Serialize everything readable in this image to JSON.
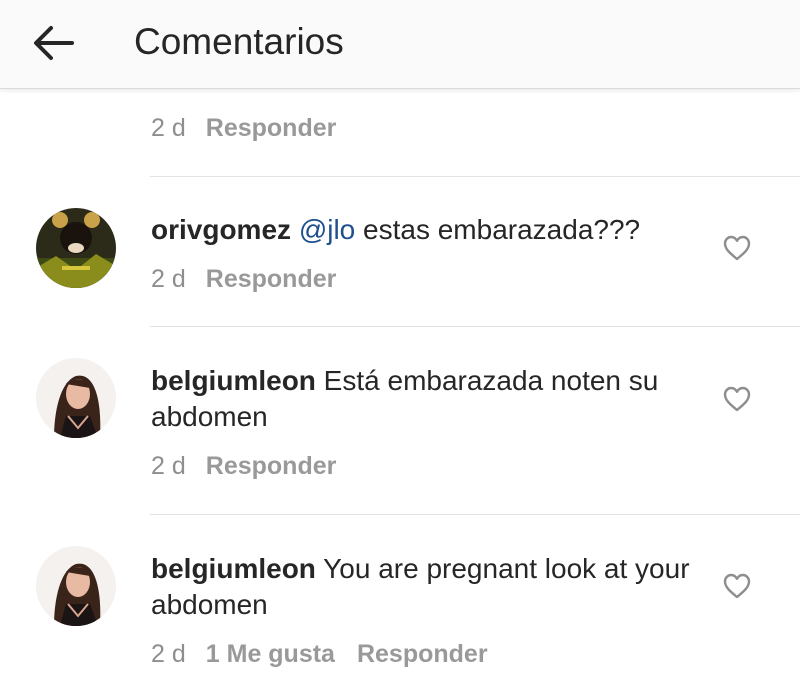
{
  "header": {
    "title": "Comentarios",
    "back_icon": "arrow-left-icon"
  },
  "colors": {
    "header_bg": "#fafafa",
    "text": "#262626",
    "meta": "#8e8e8e",
    "mention": "#1e4f8f",
    "divider": "#e3e3e3"
  },
  "comments": [
    {
      "time": "2 d",
      "reply": "Responder"
    },
    {
      "username": "orivgomez",
      "mention": "@jlo",
      "text": " estas embarazada???",
      "time": "2 d",
      "reply": "Responder",
      "icon": "heart-outline-icon"
    },
    {
      "username": "belgiumleon",
      "text": " Está embarazada noten su abdomen",
      "time": "2 d",
      "reply": "Responder",
      "icon": "heart-outline-icon"
    },
    {
      "username": "belgiumleon",
      "text": " You are pregnant look at your abdomen",
      "time": "2 d",
      "likes": "1 Me gusta",
      "reply": "Responder",
      "icon": "heart-outline-icon"
    }
  ]
}
